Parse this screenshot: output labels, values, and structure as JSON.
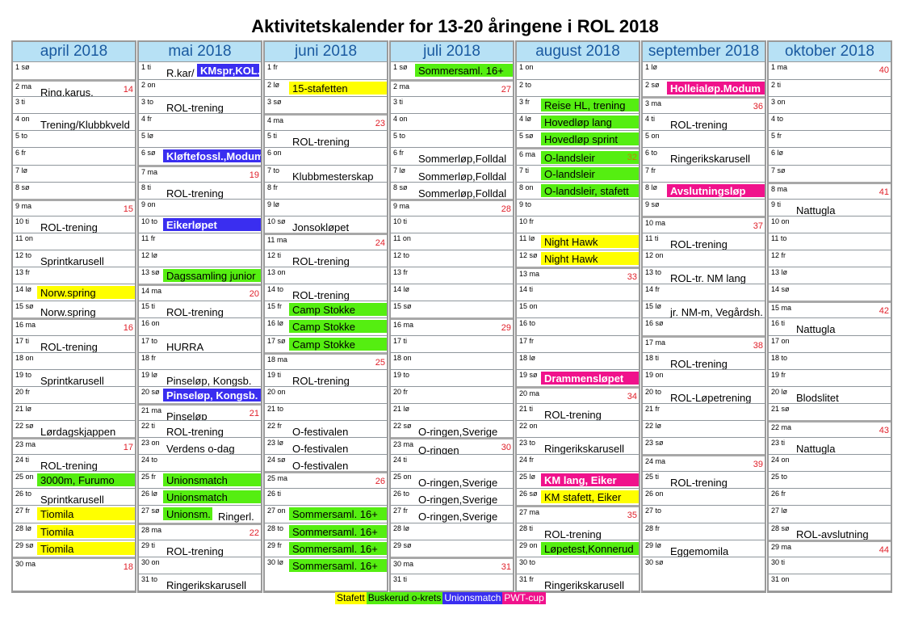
{
  "title": "Aktivitetskalender for 13-20 åringene i ROL 2018",
  "colors": {
    "stafett": "#ffff00",
    "krets": "#55ee11",
    "union": "#3a2ef0",
    "pwt": "#f0128c",
    "header_bg": "#b7e1f5",
    "header_text": "#1a5aa0",
    "week_number": "#e0202a"
  },
  "legend": [
    {
      "label": "Stafett",
      "type": "stafett"
    },
    {
      "label": "Buskerud o-krets",
      "type": "krets"
    },
    {
      "label": "Unionsmatch",
      "type": "union"
    },
    {
      "label": "PWT-cup",
      "type": "pwt"
    }
  ],
  "months": [
    {
      "name": "april 2018",
      "days": [
        {
          "d": "1 sø"
        },
        {
          "d": "2 ma",
          "wk": "14",
          "ev": "Ring.karus."
        },
        {
          "d": "3 ti"
        },
        {
          "d": "4 on",
          "ev": "Trening/Klubbkveld"
        },
        {
          "d": "5 to"
        },
        {
          "d": "6 fr"
        },
        {
          "d": "7 lø"
        },
        {
          "d": "8 sø"
        },
        {
          "d": "9 ma",
          "wk": "15"
        },
        {
          "d": "10 ti",
          "ev": "ROL-trening"
        },
        {
          "d": "11 on"
        },
        {
          "d": "12 to",
          "ev": "Sprintkarusell"
        },
        {
          "d": "13 fr"
        },
        {
          "d": "14 lø",
          "ev": "Norw.spring",
          "type": "stafett"
        },
        {
          "d": "15 sø",
          "ev": "Norw.spring"
        },
        {
          "d": "16 ma",
          "wk": "16"
        },
        {
          "d": "17 ti",
          "ev": "ROL-trening"
        },
        {
          "d": "18 on"
        },
        {
          "d": "19 to",
          "ev": "Sprintkarusell"
        },
        {
          "d": "20 fr"
        },
        {
          "d": "21 lø"
        },
        {
          "d": "22 sø",
          "ev": "Lørdagskjappen"
        },
        {
          "d": "23 ma",
          "wk": "17"
        },
        {
          "d": "24 ti",
          "ev": "ROL-trening"
        },
        {
          "d": "25 on",
          "ev": "3000m, Furumo",
          "type": "krets"
        },
        {
          "d": "26 to",
          "ev": "Sprintkarusell"
        },
        {
          "d": "27 fr",
          "ev": "Tiomila",
          "type": "stafett"
        },
        {
          "d": "28 lø",
          "ev": "Tiomila",
          "type": "stafett"
        },
        {
          "d": "29 sø",
          "ev": "Tiomila",
          "type": "stafett"
        },
        {
          "d": "30 ma",
          "wk": "18"
        }
      ]
    },
    {
      "name": "mai 2018",
      "days": [
        {
          "d": "1 ti",
          "pre": "R.kar/",
          "ev": "KMspr,KOL.",
          "type": "union"
        },
        {
          "d": "2 on"
        },
        {
          "d": "3 to",
          "ev": "ROL-trening"
        },
        {
          "d": "4 fr"
        },
        {
          "d": "5 lø"
        },
        {
          "d": "6 sø",
          "ev": "Kløftefossl.,Modum",
          "type": "union"
        },
        {
          "d": "7 ma",
          "wk": "19"
        },
        {
          "d": "8 ti",
          "ev": "ROL-trening"
        },
        {
          "d": "9 on"
        },
        {
          "d": "10 to",
          "ev": "Eikerløpet",
          "type": "union"
        },
        {
          "d": "11 fr"
        },
        {
          "d": "12 lø"
        },
        {
          "d": "13 sø",
          "ev": "Dagssamling junior",
          "type": "krets"
        },
        {
          "d": "14 ma",
          "wk": "20"
        },
        {
          "d": "15 ti",
          "ev": "ROL-trening"
        },
        {
          "d": "16 on"
        },
        {
          "d": "17 to",
          "ev": "HURRA"
        },
        {
          "d": "18 fr"
        },
        {
          "d": "19 lø",
          "ev": "Pinseløp, Kongsb."
        },
        {
          "d": "20 sø",
          "ev": "Pinseløp, Kongsb.",
          "type": "union"
        },
        {
          "d": "21 ma",
          "wk": "21",
          "ev": "Pinseløp"
        },
        {
          "d": "22 ti",
          "ev": "ROL-trening"
        },
        {
          "d": "23 on",
          "ev": "Verdens o-dag"
        },
        {
          "d": "24 to"
        },
        {
          "d": "25 fr",
          "ev": "Unionsmatch",
          "type": "krets"
        },
        {
          "d": "26 lø",
          "ev": "Unionsmatch",
          "type": "krets"
        },
        {
          "d": "27 sø",
          "ev": "Unionsm.",
          "type": "krets",
          "post": "Ringerl."
        },
        {
          "d": "28 ma",
          "wk": "22"
        },
        {
          "d": "29 ti",
          "ev": "ROL-trening"
        },
        {
          "d": "30 on"
        },
        {
          "d": "31 to",
          "ev": "Ringerikskarusell"
        }
      ]
    },
    {
      "name": "juni 2018",
      "days": [
        {
          "d": "1 fr"
        },
        {
          "d": "2 lø",
          "ev": "15-stafetten",
          "type": "stafett"
        },
        {
          "d": "3 sø"
        },
        {
          "d": "4 ma",
          "wk": "23"
        },
        {
          "d": "5 ti",
          "ev": "ROL-trening"
        },
        {
          "d": "6 on"
        },
        {
          "d": "7 to",
          "ev": "Klubbmesterskap"
        },
        {
          "d": "8 fr"
        },
        {
          "d": "9 lø"
        },
        {
          "d": "10 sø",
          "ev": "Jonsokløpet"
        },
        {
          "d": "11 ma",
          "wk": "24"
        },
        {
          "d": "12 ti",
          "ev": "ROL-trening"
        },
        {
          "d": "13 on"
        },
        {
          "d": "14 to",
          "ev": "ROL-trening"
        },
        {
          "d": "15 fr",
          "ev": "Camp Stokke",
          "type": "krets"
        },
        {
          "d": "16 lø",
          "ev": "Camp Stokke",
          "type": "krets"
        },
        {
          "d": "17 sø",
          "ev": "Camp Stokke",
          "type": "krets"
        },
        {
          "d": "18 ma",
          "wk": "25"
        },
        {
          "d": "19 ti",
          "ev": "ROL-trening"
        },
        {
          "d": "20 on"
        },
        {
          "d": "21 to"
        },
        {
          "d": "22 fr",
          "ev": "O-festivalen"
        },
        {
          "d": "23 lø",
          "ev": "O-festivalen"
        },
        {
          "d": "24 sø",
          "ev": "O-festivalen"
        },
        {
          "d": "25 ma",
          "wk": "26"
        },
        {
          "d": "26 ti"
        },
        {
          "d": "27 on",
          "ev": "Sommersaml. 16+",
          "type": "krets"
        },
        {
          "d": "28 to",
          "ev": "Sommersaml. 16+",
          "type": "krets"
        },
        {
          "d": "29 fr",
          "ev": "Sommersaml. 16+",
          "type": "krets"
        },
        {
          "d": "30 lø",
          "ev": "Sommersaml. 16+",
          "type": "krets"
        }
      ]
    },
    {
      "name": "juli 2018",
      "days": [
        {
          "d": "1 sø",
          "ev": "Sommersaml. 16+",
          "type": "krets"
        },
        {
          "d": "2 ma",
          "wk": "27"
        },
        {
          "d": "3 ti"
        },
        {
          "d": "4 on"
        },
        {
          "d": "5 to"
        },
        {
          "d": "6 fr",
          "ev": "Sommerløp,Folldal"
        },
        {
          "d": "7 lø",
          "ev": "Sommerløp,Folldal"
        },
        {
          "d": "8 sø",
          "ev": "Sommerløp,Folldal"
        },
        {
          "d": "9 ma",
          "wk": "28"
        },
        {
          "d": "10 ti"
        },
        {
          "d": "11 on"
        },
        {
          "d": "12 to"
        },
        {
          "d": "13 fr"
        },
        {
          "d": "14 lø"
        },
        {
          "d": "15 sø"
        },
        {
          "d": "16 ma",
          "wk": "29"
        },
        {
          "d": "17 ti"
        },
        {
          "d": "18 on"
        },
        {
          "d": "19 to"
        },
        {
          "d": "20 fr"
        },
        {
          "d": "21 lø"
        },
        {
          "d": "22 sø",
          "ev": "O-ringen,Sverige"
        },
        {
          "d": "23 ma",
          "wk": "30",
          "ev": "O-ringen"
        },
        {
          "d": "24 ti"
        },
        {
          "d": "25 on",
          "ev": "O-ringen,Sverige"
        },
        {
          "d": "26 to",
          "ev": "O-ringen,Sverige"
        },
        {
          "d": "27 fr",
          "ev": "O-ringen,Sverige"
        },
        {
          "d": "28 lø"
        },
        {
          "d": "29 sø"
        },
        {
          "d": "30 ma",
          "wk": "31"
        },
        {
          "d": "31 ti"
        }
      ]
    },
    {
      "name": "august 2018",
      "days": [
        {
          "d": "1 on"
        },
        {
          "d": "2 to"
        },
        {
          "d": "3 fr",
          "ev": "Reise HL, trening",
          "type": "krets"
        },
        {
          "d": "4 lø",
          "ev": "Hovedløp lang",
          "type": "krets"
        },
        {
          "d": "5 sø",
          "ev": "Hovedløp sprint",
          "type": "krets"
        },
        {
          "d": "6 ma",
          "wk": "32",
          "wkstyle": "olive",
          "ev": "O-landsleir",
          "type": "krets"
        },
        {
          "d": "7 ti",
          "ev": "O-landsleir",
          "type": "krets"
        },
        {
          "d": "8 on",
          "ev": "O-landsleir, stafett",
          "type": "krets"
        },
        {
          "d": "9 to"
        },
        {
          "d": "10 fr"
        },
        {
          "d": "11 lø",
          "ev": "Night Hawk",
          "type": "stafett"
        },
        {
          "d": "12 sø",
          "ev": "Night Hawk",
          "type": "stafett"
        },
        {
          "d": "13 ma",
          "wk": "33"
        },
        {
          "d": "14 ti"
        },
        {
          "d": "15 on"
        },
        {
          "d": "16 to"
        },
        {
          "d": "17 fr"
        },
        {
          "d": "18 lø"
        },
        {
          "d": "19 sø",
          "ev": "Drammensløpet",
          "type": "pwt"
        },
        {
          "d": "20 ma",
          "wk": "34"
        },
        {
          "d": "21 ti",
          "ev": "ROL-trening"
        },
        {
          "d": "22 on"
        },
        {
          "d": "23 to",
          "ev": "Ringerikskarusell"
        },
        {
          "d": "24 fr"
        },
        {
          "d": "25 lø",
          "ev": "KM lang, Eiker",
          "type": "pwt"
        },
        {
          "d": "26 sø",
          "ev": "KM stafett, Eiker",
          "type": "stafett"
        },
        {
          "d": "27 ma",
          "wk": "35"
        },
        {
          "d": "28 ti",
          "ev": "ROL-trening"
        },
        {
          "d": "29 on",
          "ev": "Løpetest,Konnerud",
          "type": "krets"
        },
        {
          "d": "30 to"
        },
        {
          "d": "31 fr",
          "ev": "Ringerikskarusell"
        }
      ]
    },
    {
      "name": "september 2018",
      "days": [
        {
          "d": "1 lø"
        },
        {
          "d": "2 sø",
          "ev": "Holleialøp.Modum",
          "type": "pwt"
        },
        {
          "d": "3 ma",
          "wk": "36"
        },
        {
          "d": "4 ti",
          "ev": "ROL-trening"
        },
        {
          "d": "5 on"
        },
        {
          "d": "6 to",
          "ev": "Ringerikskarusell"
        },
        {
          "d": "7 fr"
        },
        {
          "d": "8 lø",
          "ev": "Avslutningsløp",
          "type": "pwt"
        },
        {
          "d": "9 sø"
        },
        {
          "d": "10 ma",
          "wk": "37"
        },
        {
          "d": "11 ti",
          "ev": "ROL-trening"
        },
        {
          "d": "12 on"
        },
        {
          "d": "13 to",
          "ev": "ROL-tr.   NM lang"
        },
        {
          "d": "14 fr"
        },
        {
          "d": "15 lø",
          "ev": "jr. NM-m, Vegårdsh."
        },
        {
          "d": "16 sø"
        },
        {
          "d": "17 ma",
          "wk": "38"
        },
        {
          "d": "18 ti",
          "ev": "ROL-trening"
        },
        {
          "d": "19 on"
        },
        {
          "d": "20 to",
          "ev": "ROL-Løpetrening"
        },
        {
          "d": "21 fr"
        },
        {
          "d": "22 lø"
        },
        {
          "d": "23 sø"
        },
        {
          "d": "24 ma",
          "wk": "39"
        },
        {
          "d": "25 ti",
          "ev": "ROL-trening"
        },
        {
          "d": "26 on"
        },
        {
          "d": "27 to"
        },
        {
          "d": "28 fr"
        },
        {
          "d": "29 lø",
          "ev": "Eggemomila"
        },
        {
          "d": "30 sø"
        }
      ]
    },
    {
      "name": "oktober 2018",
      "days": [
        {
          "d": "1 ma",
          "wk": "40"
        },
        {
          "d": "2 ti"
        },
        {
          "d": "3 on"
        },
        {
          "d": "4 to"
        },
        {
          "d": "5 fr"
        },
        {
          "d": "6 lø"
        },
        {
          "d": "7 sø"
        },
        {
          "d": "8 ma",
          "wk": "41"
        },
        {
          "d": "9 ti",
          "ev": "Nattugla"
        },
        {
          "d": "10 on"
        },
        {
          "d": "11 to"
        },
        {
          "d": "12 fr"
        },
        {
          "d": "13 lø"
        },
        {
          "d": "14 sø"
        },
        {
          "d": "15 ma",
          "wk": "42"
        },
        {
          "d": "16 ti",
          "ev": "Nattugla"
        },
        {
          "d": "17 on"
        },
        {
          "d": "18 to"
        },
        {
          "d": "19 fr"
        },
        {
          "d": "20 lø",
          "ev": "Blodslitet"
        },
        {
          "d": "21 sø"
        },
        {
          "d": "22 ma",
          "wk": "43"
        },
        {
          "d": "23 ti",
          "ev": "Nattugla"
        },
        {
          "d": "24 on"
        },
        {
          "d": "25 to"
        },
        {
          "d": "26 fr"
        },
        {
          "d": "27 lø"
        },
        {
          "d": "28 sø",
          "ev": "ROL-avslutning"
        },
        {
          "d": "29 ma",
          "wk": "44"
        },
        {
          "d": "30 ti"
        },
        {
          "d": "31 on"
        }
      ]
    }
  ]
}
